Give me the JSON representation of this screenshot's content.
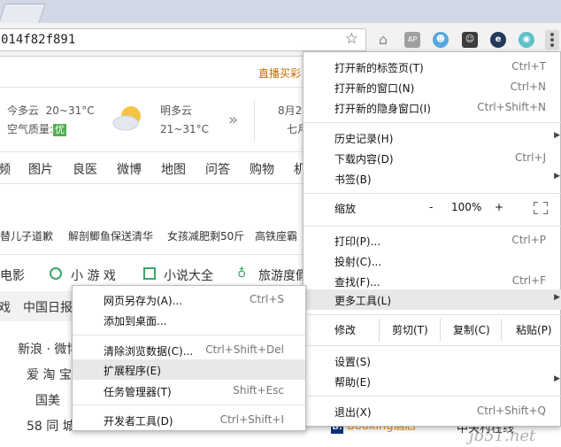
{
  "browser": {
    "tab_ghost_text": "",
    "address": "014f82f891",
    "colors": {
      "toolbar": "#f2f2f2",
      "tabstrip": "#cfd8e4",
      "highlight": "#e8e8e8"
    },
    "extensions": [
      {
        "name": "home-icon",
        "glyph": "⌂",
        "bg": "#f2f2f2",
        "fg": "#777"
      },
      {
        "name": "ap-icon",
        "glyph": "AP",
        "bg": "#9e9e9e",
        "fg": "#fff"
      },
      {
        "name": "octocat-icon",
        "glyph": "☻",
        "bg": "#56a7e0",
        "fg": "#fff"
      },
      {
        "name": "cat-icon",
        "glyph": "☺",
        "bg": "#444",
        "fg": "#fff"
      },
      {
        "name": "e-icon",
        "glyph": "e",
        "bg": "#2a3f62",
        "fg": "#fff"
      },
      {
        "name": "globe-icon",
        "glyph": "◉",
        "bg": "#5fc0c8",
        "fg": "#fff"
      }
    ]
  },
  "page": {
    "hotlink": "直播买彩",
    "weather_today": {
      "cond": "今多云",
      "temp": "20~31°C",
      "aq_label": "空气质量:",
      "aq_value": "优"
    },
    "weather_tomorrow": {
      "cond": "明多云",
      "temp": "21~31°C"
    },
    "date_line1": "8月2",
    "date_line2": "七月",
    "nav": [
      "频",
      "图片",
      "良医",
      "微博",
      "地图",
      "问答",
      "购物",
      "机"
    ],
    "news": [
      "替儿子道歉",
      "解剖鲫鱼保送清华",
      "女孩减肥剩50斤",
      "高铁座霸"
    ],
    "categories": [
      "电影",
      "小 游 戏",
      "小说大全",
      "旅游度假"
    ],
    "row_left": "戏",
    "row_mid": "中国日报",
    "links": [
      "新浪 · 微博",
      "爱 淘 宝",
      "国美",
      "58 同 城"
    ],
    "booking": "Booking酒店",
    "village": "中关村在线",
    "watermark": "jb51.net"
  },
  "menu": {
    "items_top": [
      {
        "label": "打开新的标签页(T)",
        "shortcut": "Ctrl+T"
      },
      {
        "label": "打开新的窗口(N)",
        "shortcut": "Ctrl+N"
      },
      {
        "label": "打开新的隐身窗口(I)",
        "shortcut": "Ctrl+Shift+N"
      }
    ],
    "items_mid": [
      {
        "label": "历史记录(H)",
        "shortcut": ""
      },
      {
        "label": "下载内容(D)",
        "shortcut": "Ctrl+J"
      },
      {
        "label": "书签(B)",
        "shortcut": ""
      }
    ],
    "zoom": {
      "label": "缩放",
      "minus": "-",
      "value": "100%",
      "plus": "+"
    },
    "items_tools": [
      {
        "label": "打印(P)...",
        "shortcut": "Ctrl+P"
      },
      {
        "label": "投射(C)...",
        "shortcut": ""
      },
      {
        "label": "查找(F)...",
        "shortcut": "Ctrl+F"
      },
      {
        "label": "更多工具(L)",
        "shortcut": ""
      }
    ],
    "edit": {
      "label": "修改",
      "cut": "剪切(T)",
      "copy": "复制(C)",
      "paste": "粘贴(P)"
    },
    "items_settings": [
      {
        "label": "设置(S)",
        "shortcut": ""
      },
      {
        "label": "帮助(E)",
        "shortcut": ""
      }
    ],
    "exit": {
      "label": "退出(X)",
      "shortcut": "Ctrl+Shift+Q"
    }
  },
  "submenu": {
    "group1": [
      {
        "label": "网页另存为(A)...",
        "shortcut": "Ctrl+S"
      },
      {
        "label": "添加到桌面...",
        "shortcut": ""
      }
    ],
    "group2": [
      {
        "label": "清除浏览数据(C)...",
        "shortcut": "Ctrl+Shift+Del"
      },
      {
        "label": "扩展程序(E)",
        "shortcut": ""
      },
      {
        "label": "任务管理器(T)",
        "shortcut": "Shift+Esc"
      }
    ],
    "group3": [
      {
        "label": "开发者工具(D)",
        "shortcut": "Ctrl+Shift+I"
      }
    ]
  }
}
